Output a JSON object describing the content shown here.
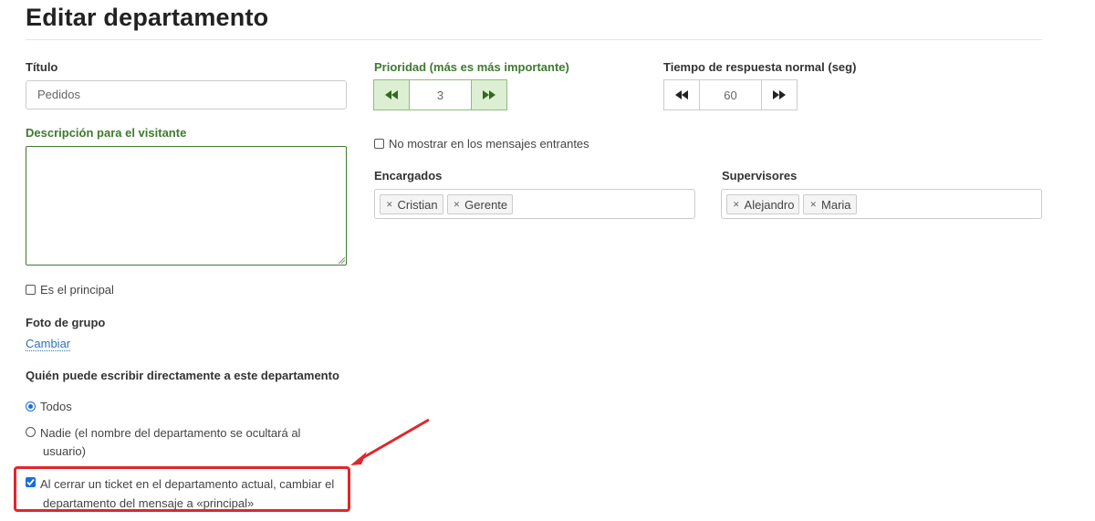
{
  "page": {
    "title": "Editar departamento"
  },
  "form": {
    "title_label": "Título",
    "title_value": "Pedidos",
    "description_label": "Descripción para el visitante",
    "description_value": "",
    "is_main_label": "Es el principal",
    "is_main_checked": false,
    "group_photo_label": "Foto de grupo",
    "change_link": "Cambiar",
    "who_can_write_label": "Quién puede escribir directamente a este departamento",
    "radio_all_label": "Todos",
    "radio_all_checked": true,
    "radio_none_label_line1": "Nadie (el nombre del departamento se ocultará al",
    "radio_none_label_line2": "usuario)",
    "radio_none_checked": false,
    "close_ticket_label_line1": "Al cerrar un ticket en el departamento actual, cambiar el",
    "close_ticket_label_line2": "departamento del mensaje a «principal»",
    "close_ticket_checked": true,
    "priority_label": "Prioridad (más es más importante)",
    "priority_value": "3",
    "response_time_label": "Tiempo de respuesta normal (seg)",
    "response_time_value": "60",
    "hide_incoming_label": "No mostrar en los mensajes entrantes",
    "hide_incoming_checked": false,
    "assignees_label": "Encargados",
    "assignees": [
      "Cristian",
      "Gerente"
    ],
    "supervisors_label": "Supervisores",
    "supervisors": [
      "Alejandro",
      "Maria"
    ]
  },
  "icons": {
    "decrement": "double-chevron-left-icon",
    "increment": "double-chevron-right-icon",
    "remove_tag": "close-icon"
  },
  "colors": {
    "green_label": "#3d7a2e",
    "accent_blue": "#1a6ed8",
    "highlight_red": "#e0262b"
  }
}
